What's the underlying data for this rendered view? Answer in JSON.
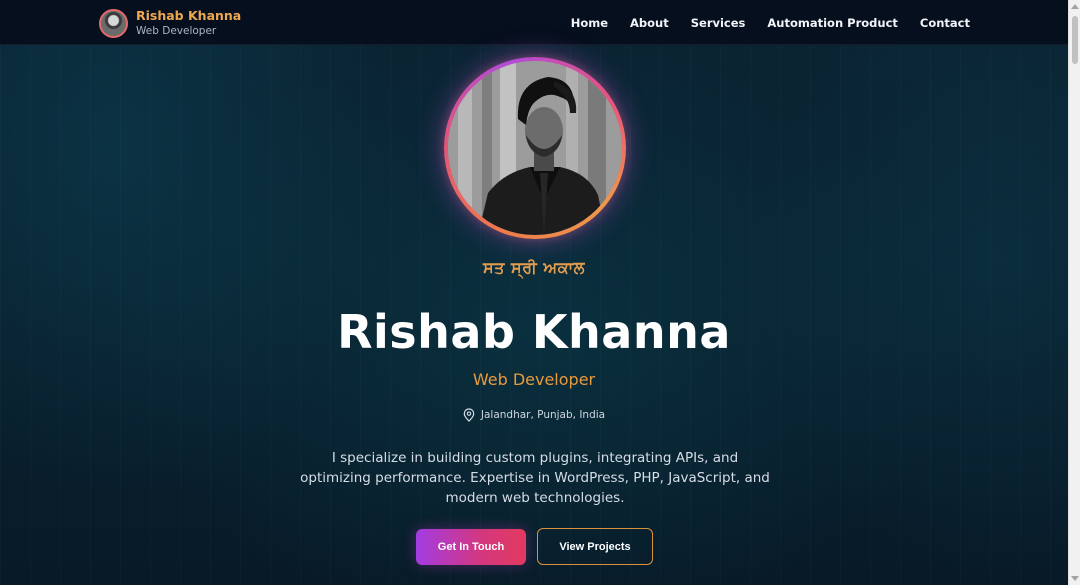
{
  "header": {
    "brand_name": "Rishab Khanna",
    "brand_role": "Web Developer",
    "nav": [
      "Home",
      "About",
      "Services",
      "Automation Product",
      "Contact"
    ]
  },
  "hero": {
    "greeting": "ਸਤ ਸ੍ਰੀ ਅਕਾਲ",
    "name": "Rishab Khanna",
    "role": "Web Developer",
    "location": "Jalandhar, Punjab, India",
    "bio": "I specialize in building custom plugins, integrating APIs, and optimizing performance. Expertise in WordPress, PHP, JavaScript, and modern web technologies.",
    "primary_button": "Get In Touch",
    "secondary_button": "View Projects"
  },
  "icons": {
    "location": "map-pin-icon",
    "avatar": "profile-photo"
  },
  "colors": {
    "accent_orange": "#e89a3e",
    "accent_purple": "#a23ce2",
    "accent_pink": "#e23a5e",
    "background": "#071726"
  }
}
